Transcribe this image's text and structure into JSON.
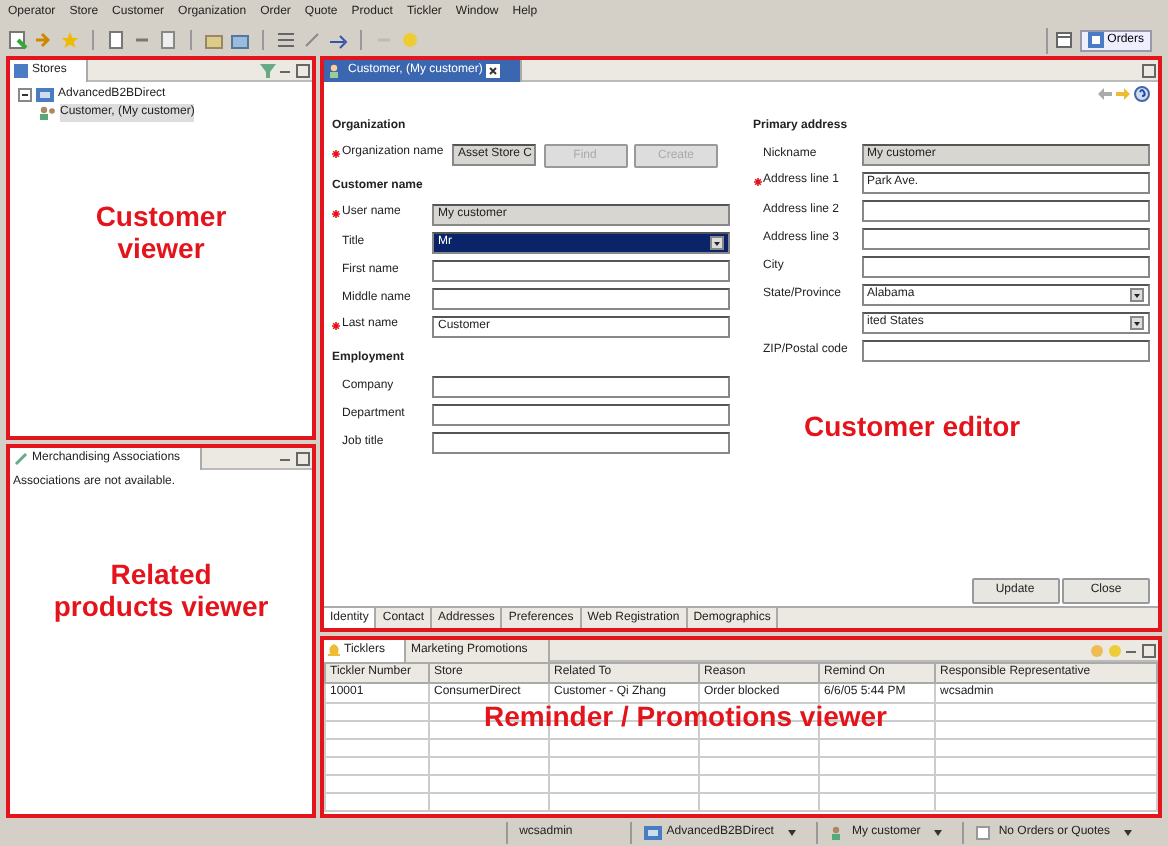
{
  "menu_bar": [
    "Operator",
    "Store",
    "Customer",
    "Organization",
    "Order",
    "Quote",
    "Product",
    "Tickler",
    "Window",
    "Help"
  ],
  "perspective": {
    "label": "Orders",
    "selected": true
  },
  "stores_view": {
    "title": "Stores",
    "callout": "Customer viewer",
    "tree": [
      {
        "label": "AdvancedB2BDirect",
        "expanded": true,
        "selected": false,
        "children": [
          {
            "label": "Customer, (My customer)",
            "selected": true
          }
        ]
      }
    ]
  },
  "associations_view": {
    "title": "Merchandising Associations",
    "message": "Associations are not available.",
    "callout": "Related products viewer"
  },
  "editor": {
    "tab": "Customer, (My customer)",
    "callout": "Customer editor",
    "organization": {
      "heading": "Organization",
      "label": "Organization name",
      "required": true,
      "value": "Asset Store C",
      "buttons": [
        {
          "label": "Find",
          "disabled": true
        },
        {
          "label": "Create",
          "disabled": true
        }
      ]
    },
    "left_sections": [
      {
        "heading": "Customer name",
        "fields": [
          {
            "label": "User name",
            "required": true,
            "kind": "readonly",
            "value": "My customer"
          },
          {
            "label": "Title",
            "required": false,
            "kind": "select",
            "value": "Mr",
            "focused": true
          },
          {
            "label": "First name",
            "required": false,
            "kind": "text"
          },
          {
            "label": "Middle name",
            "required": false,
            "kind": "text"
          },
          {
            "label": "Last name",
            "required": true,
            "kind": "text",
            "value": "Customer"
          }
        ]
      },
      {
        "heading": "Employment",
        "fields": [
          {
            "label": "Company",
            "required": false,
            "kind": "text"
          },
          {
            "label": "Department",
            "required": false,
            "kind": "text"
          },
          {
            "label": "Job title",
            "required": false,
            "kind": "text"
          }
        ]
      }
    ],
    "right_sections": [
      {
        "heading": "Primary address",
        "fields": [
          {
            "label": "Nickname",
            "required": false,
            "kind": "readonly",
            "value": "My customer"
          },
          {
            "label": "Address line 1",
            "required": true,
            "kind": "text",
            "value": "Park Ave."
          },
          {
            "label": "Address line 2",
            "required": false,
            "kind": "text"
          },
          {
            "label": "Address line 3",
            "required": false,
            "kind": "text"
          },
          {
            "label": "City",
            "required": false,
            "kind": "text"
          },
          {
            "label": "State/Province",
            "required": false,
            "kind": "select",
            "value": "Alabama",
            "focused": false
          },
          {
            "required": false,
            "kind": "select",
            "value": "ited States",
            "focused": false
          },
          {
            "label": "ZIP/Postal code",
            "required": false,
            "kind": "text"
          }
        ]
      }
    ],
    "buttons": [
      {
        "label": "Update",
        "disabled": false
      },
      {
        "label": "Close",
        "disabled": false
      }
    ],
    "page_tabs": [
      {
        "label": "Identity",
        "selected": true
      },
      {
        "label": "Contact",
        "selected": false
      },
      {
        "label": "Addresses",
        "selected": false
      },
      {
        "label": "Preferences",
        "selected": false
      },
      {
        "label": "Web Registration",
        "selected": false
      },
      {
        "label": "Demographics",
        "selected": false
      }
    ]
  },
  "bottom_view": {
    "callout": "Reminder / Promotions viewer",
    "tabs": [
      {
        "label": "Ticklers",
        "selected": true
      },
      {
        "label": "Marketing Promotions",
        "selected": false
      }
    ],
    "table": {
      "columns": [
        "Tickler Number",
        "Store",
        "Related To",
        "Reason",
        "Remind On",
        "Responsible Representative"
      ],
      "rows": [
        [
          "10001",
          "ConsumerDirect",
          "Customer - Qi Zhang",
          "Order blocked",
          "6/6/05 5:44 PM",
          "wcsadmin"
        ]
      ]
    }
  },
  "status_bar": [
    {
      "label": "wcsadmin",
      "kind": "plain"
    },
    {
      "label": "AdvancedB2BDirect",
      "kind": "store"
    },
    {
      "label": "My customer",
      "kind": "customer"
    },
    {
      "label": "No Orders or Quotes",
      "kind": "order"
    }
  ]
}
